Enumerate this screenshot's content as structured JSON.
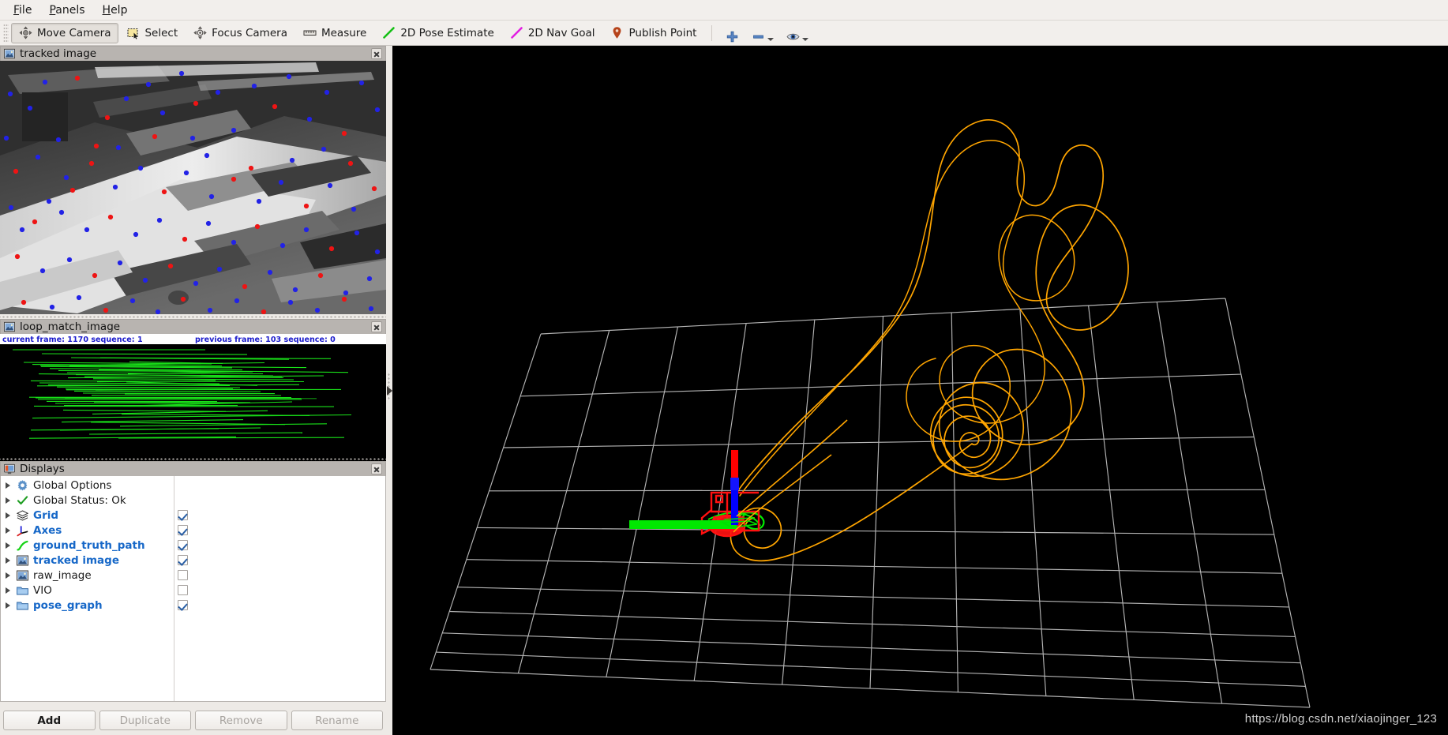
{
  "window": {
    "title": "RViz",
    "background_color": "#000000",
    "chrome_color": "#f2efec"
  },
  "menubar": {
    "items": [
      {
        "label": "File",
        "mnemonic": "F",
        "rest": "ile"
      },
      {
        "label": "Panels",
        "mnemonic": "P",
        "rest": "anels"
      },
      {
        "label": "Help",
        "mnemonic": "H",
        "rest": "elp"
      }
    ]
  },
  "toolbar": {
    "buttons": [
      {
        "label": "Move Camera",
        "icon": "move-camera-icon",
        "active": true
      },
      {
        "label": "Select",
        "icon": "select-icon",
        "active": false
      },
      {
        "label": "Focus Camera",
        "icon": "focus-camera-icon",
        "active": false
      },
      {
        "label": "Measure",
        "icon": "measure-icon",
        "active": false
      },
      {
        "label": "2D Pose Estimate",
        "icon": "pose-estimate-icon",
        "active": false
      },
      {
        "label": "2D Nav Goal",
        "icon": "nav-goal-icon",
        "active": false
      },
      {
        "label": "Publish Point",
        "icon": "publish-point-icon",
        "active": false
      }
    ],
    "mini_tools": [
      {
        "icon": "plus-icon",
        "has_caret": false
      },
      {
        "icon": "minus-icon",
        "has_caret": true
      },
      {
        "icon": "eye-icon",
        "has_caret": true
      }
    ]
  },
  "panels": {
    "tracked_image": {
      "title": "tracked image",
      "icon": "image-display-icon",
      "close_label": "Close"
    },
    "loop_match_image": {
      "title": "loop_match_image",
      "icon": "image-display-icon",
      "close_label": "Close",
      "overlay": {
        "left_text": "current frame: 1170   sequence: 1",
        "right_text": "previous frame: 103   sequence: 0",
        "text_color": "#1a1acc",
        "background_color": "#ffffff"
      }
    },
    "displays": {
      "title": "Displays",
      "icon": "displays-panel-icon",
      "close_label": "Close",
      "tree": [
        {
          "label": "Global Options",
          "icon": "gear-icon",
          "highlighted": false,
          "checkbox": null
        },
        {
          "label": "Global Status: Ok",
          "icon": "check-status-icon",
          "highlighted": false,
          "checkbox": null
        },
        {
          "label": "Grid",
          "icon": "grid-icon",
          "highlighted": true,
          "checkbox": true
        },
        {
          "label": "Axes",
          "icon": "axes-icon",
          "highlighted": true,
          "checkbox": true
        },
        {
          "label": "ground_truth_path",
          "icon": "path-icon",
          "highlighted": true,
          "checkbox": true
        },
        {
          "label": "tracked image",
          "icon": "image-display-icon",
          "highlighted": true,
          "checkbox": true
        },
        {
          "label": "raw_image",
          "icon": "image-display-icon",
          "highlighted": false,
          "checkbox": false
        },
        {
          "label": "VIO",
          "icon": "folder-icon",
          "highlighted": false,
          "checkbox": false
        },
        {
          "label": "pose_graph",
          "icon": "folder-icon",
          "highlighted": true,
          "checkbox": true
        }
      ],
      "buttons": [
        {
          "label": "Add",
          "enabled": true
        },
        {
          "label": "Duplicate",
          "enabled": false
        },
        {
          "label": "Remove",
          "enabled": false
        },
        {
          "label": "Rename",
          "enabled": false
        }
      ]
    }
  },
  "dock_handle": {
    "icon": "collapse-left-icon",
    "direction": "left"
  },
  "view3d": {
    "background_color": "#000000",
    "grid": {
      "color": "#b4b4b4",
      "cells": 10,
      "plane": "XY"
    },
    "axes": {
      "x_color": "#ff0000",
      "y_color": "#00ff00",
      "z_color": "#0000ff"
    },
    "paths": [
      {
        "name": "pose_graph_path",
        "color": "#ffa500"
      },
      {
        "name": "ground_truth_path",
        "color": "#00ff00"
      },
      {
        "name": "camera_frustum_marker",
        "color": "#ff0000"
      }
    ],
    "watermark": "https://blog.csdn.net/xiaojinger_123"
  }
}
